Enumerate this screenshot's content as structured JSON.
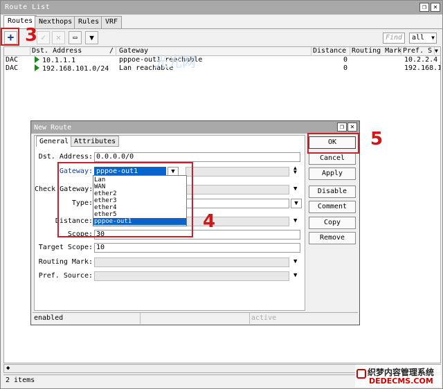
{
  "window": {
    "title": "Route List"
  },
  "tabs": [
    "Routes",
    "Nexthops",
    "Rules",
    "VRF"
  ],
  "toolbar": {
    "find_placeholder": "Find",
    "filter_value": "all"
  },
  "table": {
    "columns": [
      "",
      "Dst. Address",
      "/",
      "Gateway",
      "Distance",
      "Routing Mark",
      "Pref. S"
    ],
    "rows": [
      {
        "flags": "DAC",
        "dst": "10.1.1.1",
        "gateway": "pppoe-out1 reachable",
        "distance": "0",
        "routing_mark": "",
        "pref": "10.2.2.4"
      },
      {
        "flags": "DAC",
        "dst": "192.168.101.0/24",
        "gateway": "Lan reachable",
        "distance": "0",
        "routing_mark": "",
        "pref": "192.168.1"
      }
    ]
  },
  "status": {
    "items": "2 items"
  },
  "watermark": "光光网",
  "bottom_watermark": {
    "line1": "织梦内容管理系统",
    "line2": "DEDECMS.COM"
  },
  "dialog": {
    "title": "New Route",
    "tabs": [
      "General",
      "Attributes"
    ],
    "labels": {
      "dst": "Dst. Address:",
      "gateway": "Gateway:",
      "check_gateway": "Check Gateway:",
      "type": "Type:",
      "distance": "Distance:",
      "scope": "Scope:",
      "target_scope": "Target Scope:",
      "routing_mark": "Routing Mark:",
      "pref_source": "Pref. Source:"
    },
    "values": {
      "dst": "0.0.0.0/0",
      "gateway": "pppoe-out1",
      "scope": "30",
      "target_scope": "10"
    },
    "gateway_options": [
      "Lan",
      "WAN",
      "ether2",
      "ether3",
      "ether4",
      "ether5",
      "pppoe-out1"
    ],
    "gateway_selected": "pppoe-out1",
    "buttons": [
      "OK",
      "Cancel",
      "Apply",
      "Disable",
      "Comment",
      "Copy",
      "Remove"
    ],
    "status": {
      "left": "enabled",
      "right": "active"
    }
  },
  "annotations": {
    "n3": "3",
    "n4": "4",
    "n5": "5"
  }
}
